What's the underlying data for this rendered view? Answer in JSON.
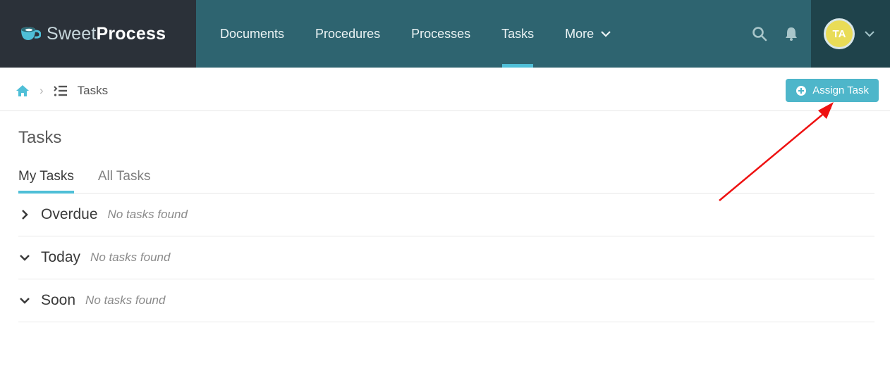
{
  "brand": {
    "light": "Sweet",
    "bold": "Process"
  },
  "nav": {
    "items": [
      {
        "label": "Documents",
        "active": false
      },
      {
        "label": "Procedures",
        "active": false
      },
      {
        "label": "Processes",
        "active": false
      },
      {
        "label": "Tasks",
        "active": true
      },
      {
        "label": "More",
        "active": false,
        "dropdown": true
      }
    ]
  },
  "user": {
    "initials": "TA"
  },
  "breadcrumb": {
    "label": "Tasks"
  },
  "assign_button": {
    "label": "Assign Task"
  },
  "page": {
    "title": "Tasks",
    "tabs": [
      {
        "label": "My Tasks",
        "active": true
      },
      {
        "label": "All Tasks",
        "active": false
      }
    ],
    "sections": [
      {
        "label": "Overdue",
        "empty_text": "No tasks found",
        "expanded": false
      },
      {
        "label": "Today",
        "empty_text": "No tasks found",
        "expanded": true
      },
      {
        "label": "Soon",
        "empty_text": "No tasks found",
        "expanded": true
      }
    ]
  },
  "colors": {
    "nav_dark": "#2b3139",
    "nav_teal": "#2e6470",
    "nav_teal_dark": "#1f434b",
    "accent": "#4fbfd7",
    "button": "#4eb6ca",
    "avatar_bg": "#e9dc57"
  }
}
